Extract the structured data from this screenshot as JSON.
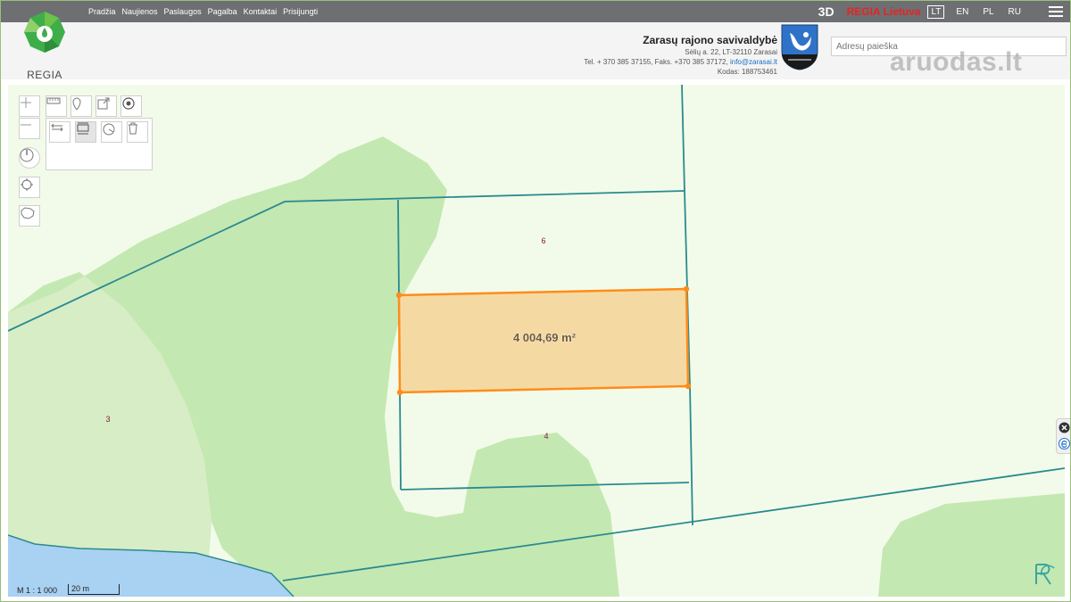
{
  "topbar": {
    "nav": [
      "Pradžia",
      "Naujienos",
      "Paslaugos",
      "Pagalba",
      "Kontaktai",
      "Prisijungti"
    ],
    "btn_3d": "3D",
    "regia": "REGIA Lietuva",
    "languages": [
      "LT",
      "EN",
      "PL",
      "RU"
    ],
    "active_language": "LT"
  },
  "logo": {
    "text": "REGIA"
  },
  "municipality": {
    "name": "Zarasų rajono savivaldybė",
    "address": "Sėlių a. 22, LT-32110 Zarasai",
    "phone": "Tel. + 370 385 37155, Faks. +370 385 37172,",
    "email": "info@zarasai.lt",
    "code": "Kodas: 188753461"
  },
  "search": {
    "placeholder": "Adresų paieška"
  },
  "watermark": "aruodas.lt",
  "map": {
    "area_label": "4 004,69 m²",
    "parcel_labels": [
      "6",
      "4",
      "3"
    ],
    "scale": "M 1 : 1 000",
    "scale_bar": "20 m"
  },
  "colors": {
    "topbar": "#6d6f73",
    "map_bg": "#f2fbe9",
    "forest": "#c4e8b2",
    "forest_light": "#d6edc6",
    "water": "#a9d1f2",
    "boundary": "#2a8a8f",
    "selection_stroke": "#ff8c1a",
    "selection_fill": "#f5d9a3",
    "label": "#8b1a3a"
  }
}
